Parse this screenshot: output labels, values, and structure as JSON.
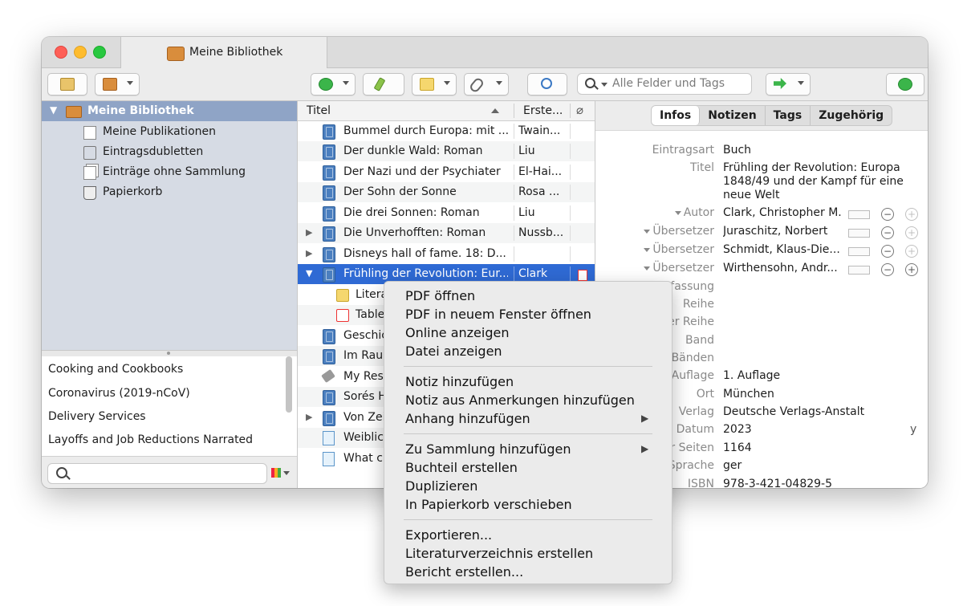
{
  "window": {
    "tab_title": "Meine Bibliothek"
  },
  "toolbar": {
    "search_placeholder": "Alle Felder und Tags"
  },
  "sidebar": {
    "library": "Meine Bibliothek",
    "items": [
      {
        "label": "Meine Publikationen",
        "icon": "document-icon"
      },
      {
        "label": "Eintragsdubletten",
        "icon": "duplicates-icon"
      },
      {
        "label": "Einträge ohne Sammlung",
        "icon": "unfiled-icon"
      },
      {
        "label": "Papierkorb",
        "icon": "trash-icon"
      }
    ]
  },
  "tags": {
    "lines": [
      "Cooking and Cookbooks",
      "Coronavirus (2019-nCoV)",
      "Delivery Services",
      "Layoffs and Job Reductions   Narrated"
    ]
  },
  "items_header": {
    "title": "Titel",
    "creator": "Erste..."
  },
  "items": [
    {
      "title": "Bummel durch Europa: mit ...",
      "creator": "Twain..."
    },
    {
      "title": "Der dunkle Wald: Roman",
      "creator": "Liu"
    },
    {
      "title": "Der Nazi und der Psychiater",
      "creator": "El-Hai..."
    },
    {
      "title": "Der Sohn der Sonne",
      "creator": "Rosa ..."
    },
    {
      "title": "Die drei Sonnen: Roman",
      "creator": "Liu"
    },
    {
      "title": "Die Unverhofften: Roman",
      "creator": "Nussb..."
    },
    {
      "title": "Disneys hall of fame. 18: D...",
      "creator": ""
    },
    {
      "title": "Frühling der Revolution: Eur...",
      "creator": "Clark"
    },
    {
      "title": "Litera",
      "creator": ""
    },
    {
      "title": "Table",
      "creator": ""
    },
    {
      "title": "Geschic",
      "creator": ""
    },
    {
      "title": "Im Raum",
      "creator": ""
    },
    {
      "title": "My Rest",
      "creator": ""
    },
    {
      "title": "Sorés H",
      "creator": ""
    },
    {
      "title": "Von Zei",
      "creator": ""
    },
    {
      "title": "Weiblich",
      "creator": ""
    },
    {
      "title": "What cr",
      "creator": ""
    }
  ],
  "info_tabs": [
    "Infos",
    "Notizen",
    "Tags",
    "Zugehörig"
  ],
  "info": {
    "type_label": "Eintragsart",
    "type_value": "Buch",
    "title_label": "Titel",
    "title_value": "Frühling der Revolution: Europa 1848/49 und der Kampf für eine neue Welt",
    "creators": [
      {
        "label": "Autor",
        "value": "Clark, Christopher M."
      },
      {
        "label": "Übersetzer",
        "value": "Juraschitz, Norbert"
      },
      {
        "label": "Übersetzer",
        "value": "Schmidt, Klaus-Die..."
      },
      {
        "label": "Übersetzer",
        "value": "Wirthensohn, Andr..."
      }
    ],
    "fields": [
      {
        "label": "fassung",
        "value": ""
      },
      {
        "label": "Reihe",
        "value": ""
      },
      {
        "label": "er Reihe",
        "value": ""
      },
      {
        "label": "Band",
        "value": ""
      },
      {
        "label": "Bänden",
        "value": ""
      },
      {
        "label": "Auflage",
        "value": "1. Auflage"
      },
      {
        "label": "Ort",
        "value": "München"
      },
      {
        "label": "Verlag",
        "value": "Deutsche Verlags-Anstalt"
      },
      {
        "label": "Datum",
        "value": "2023"
      },
      {
        "label": "er Seiten",
        "value": "1164"
      },
      {
        "label": "Sprache",
        "value": "ger"
      },
      {
        "label": "ISBN",
        "value": "978-3-421-04829-5"
      }
    ],
    "date_suffix": "y"
  },
  "context_menu": {
    "group1": [
      "PDF öffnen",
      "PDF in neuem Fenster öffnen",
      "Online anzeigen",
      "Datei anzeigen"
    ],
    "group2": [
      "Notiz hinzufügen",
      "Notiz aus Anmerkungen hinzufügen",
      "Anhang hinzufügen"
    ],
    "group3": [
      "Zu Sammlung hinzufügen",
      "Buchteil erstellen",
      "Duplizieren",
      "In Papierkorb verschieben"
    ],
    "group4": [
      "Exportieren...",
      "Literaturverzeichnis erstellen",
      "Bericht erstellen..."
    ],
    "submenu_arrow": "▶"
  },
  "colors": {
    "selection": "#2f6ad4",
    "sidebar_selection": "#8fa4c6",
    "sidebar_bg": "#d6dbe4"
  }
}
